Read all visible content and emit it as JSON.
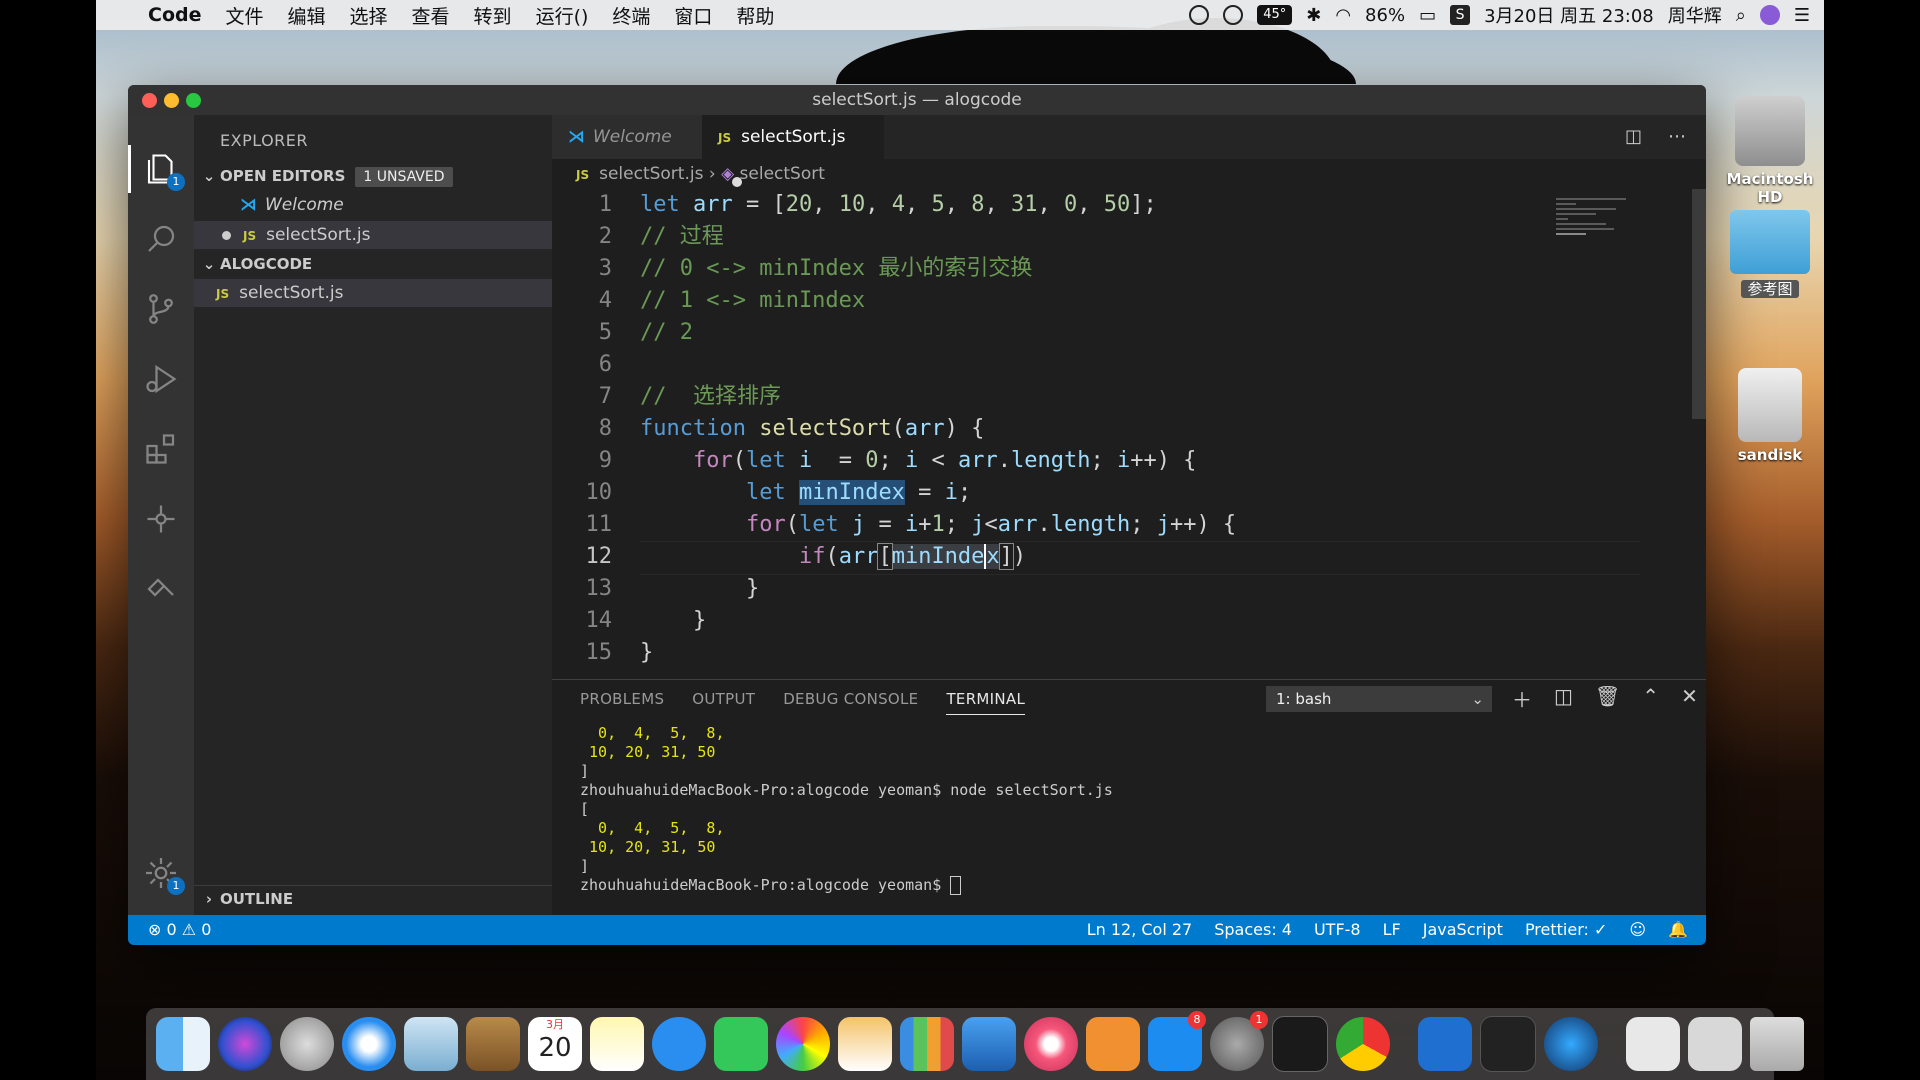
{
  "menubar": {
    "app": "Code",
    "menus": [
      "文件",
      "编辑",
      "选择",
      "查看",
      "转到",
      "运行()",
      "终端",
      "窗口",
      "帮助"
    ],
    "temp": "45°",
    "battery": "86%",
    "datetime": "3月20日 周五 23:08",
    "user": "周华辉"
  },
  "window": {
    "title": "selectSort.js — alogcode"
  },
  "activity": {
    "explorer_badge": "1",
    "settings_badge": "1"
  },
  "sidebar": {
    "title": "EXPLORER",
    "open_editors": "OPEN EDITORS",
    "unsaved": "1 UNSAVED",
    "open_items": [
      "Welcome",
      "selectSort.js"
    ],
    "folder": "ALOGCODE",
    "files": [
      "selectSort.js"
    ],
    "outline": "OUTLINE",
    "js_label": "JS"
  },
  "tabs": [
    {
      "label": "Welcome"
    },
    {
      "label": "selectSort.js"
    }
  ],
  "breadcrumb": {
    "file": "selectSort.js",
    "symbol": "selectSort"
  },
  "editor": {
    "line_numbers": [
      "1",
      "2",
      "3",
      "4",
      "5",
      "6",
      "7",
      "8",
      "9",
      "10",
      "11",
      "12",
      "13",
      "14",
      "15"
    ],
    "current_line": 12
  },
  "panel": {
    "tabs": [
      "PROBLEMS",
      "OUTPUT",
      "DEBUG CONSOLE",
      "TERMINAL"
    ],
    "active": "TERMINAL",
    "shell": "1: bash",
    "terminal": [
      "  0,  4,  5,  8,",
      " 10, 20, 31, 50",
      "]",
      "zhouhuahuideMacBook-Pro:alogcode yeoman$ node selectSort.js",
      "[",
      "  0,  4,  5,  8,",
      " 10, 20, 31, 50",
      "]",
      "zhouhuahuideMacBook-Pro:alogcode yeoman$ "
    ]
  },
  "status": {
    "errors": "⊗ 0 ⚠ 0",
    "position": "Ln 12, Col 27",
    "spaces": "Spaces: 4",
    "encoding": "UTF-8",
    "eol": "LF",
    "language": "JavaScript",
    "prettier": "Prettier: ✓"
  },
  "desktop": {
    "hd": "Macintosh HD",
    "folder": "参考图",
    "usb": "sandisk"
  },
  "dock": {
    "calendar_month": "3月",
    "calendar_day": "20",
    "appstore_badge": "8",
    "prefs_badge": "1"
  }
}
